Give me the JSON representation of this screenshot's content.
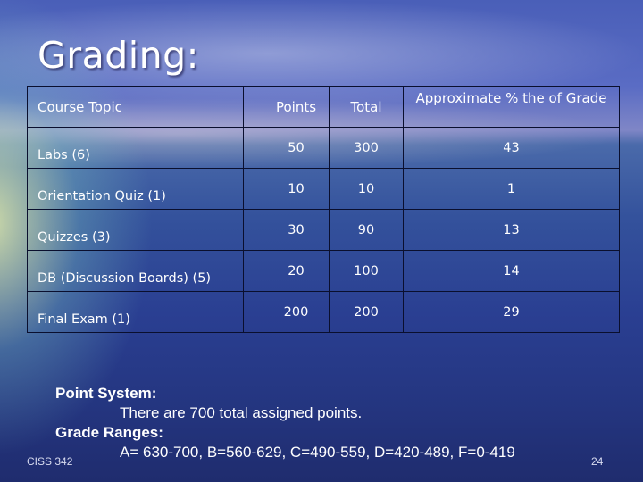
{
  "slide": {
    "title": "Grading:",
    "footer_left": "CISS 342",
    "page_number": "24"
  },
  "table": {
    "headers": {
      "topic": "Course Topic",
      "empty": "",
      "points": "Points",
      "total": "Total",
      "approx": "Approximate % the of Grade"
    },
    "rows": [
      {
        "topic": "Labs (6)",
        "points": "50",
        "total": "300",
        "approx": "43"
      },
      {
        "topic": "Orientation Quiz (1)",
        "points": "10",
        "total": "10",
        "approx": "1"
      },
      {
        "topic": "Quizzes (3)",
        "points": "30",
        "total": "90",
        "approx": "13"
      },
      {
        "topic": "DB (Discussion Boards) (5)",
        "points": "20",
        "total": "100",
        "approx": "14"
      },
      {
        "topic": "Final Exam (1)",
        "points": "200",
        "total": "200",
        "approx": "29"
      }
    ]
  },
  "notes": {
    "point_system_heading": "Point System:",
    "point_system_text": "There are 700 total assigned points.",
    "grade_ranges_heading": "Grade Ranges:",
    "grade_ranges_text": "A= 630-700, B=560-629, C=490-559, D=420-489, F=0-419"
  }
}
